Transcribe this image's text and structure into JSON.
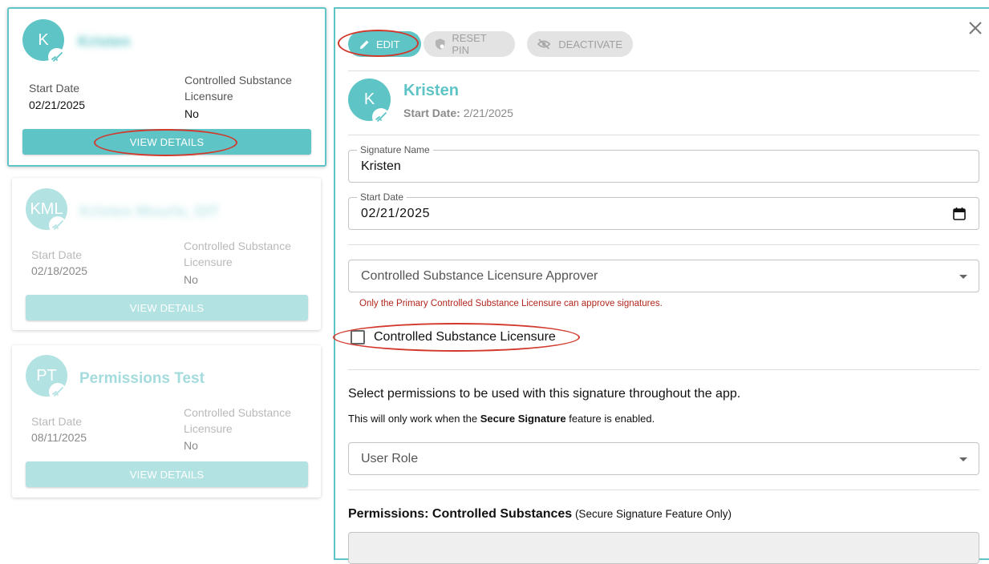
{
  "cards": [
    {
      "initials": "K",
      "name": "Kristen",
      "start_date_label": "Start Date",
      "start_date": "02/21/2025",
      "csl_label_line1": "Controlled Substance",
      "csl_label_line2": "Licensure",
      "csl_value": "No",
      "button": "VIEW DETAILS"
    },
    {
      "initials": "KML",
      "name": "Kristen Mourle, DIT",
      "start_date_label": "Start Date",
      "start_date": "02/18/2025",
      "csl_label_line1": "Controlled Substance",
      "csl_label_line2": "Licensure",
      "csl_value": "No",
      "button": "VIEW DETAILS"
    },
    {
      "initials": "PT",
      "name": "Permissions Test",
      "start_date_label": "Start Date",
      "start_date": "08/11/2025",
      "csl_label_line1": "Controlled Substance",
      "csl_label_line2": "Licensure",
      "csl_value": "No",
      "button": "VIEW DETAILS"
    }
  ],
  "panel": {
    "toolbar": {
      "edit": "EDIT",
      "reset_pin": "RESET PIN",
      "deactivate": "DEACTIVATE"
    },
    "initials": "K",
    "name": "Kristen",
    "start_label": "Start Date:",
    "start_value": "2/21/2025",
    "signature_name_label": "Signature Name",
    "signature_name_value": "Kristen",
    "start_date_field_label": "Start Date",
    "start_date_field_value": "02/21/2025",
    "approver_placeholder": "Controlled Substance Licensure Approver",
    "approver_hint": "Only the Primary Controlled Substance Licensure can approve signatures.",
    "csl_checkbox_label": "Controlled Substance Licensure",
    "permissions_heading": "Select permissions to be used with this signature throughout the app.",
    "permissions_note_pre": "This will only work when the ",
    "permissions_note_bold": "Secure Signature",
    "permissions_note_post": " feature is enabled.",
    "user_role_placeholder": "User Role",
    "perm_cs_title": "Permissions: Controlled Substances",
    "perm_cs_suffix": " (Secure Signature Feature Only)"
  },
  "colors": {
    "accent": "#5fc4c6",
    "accent_light": "#b3e2e3",
    "error": "#b3261e",
    "annotation": "#d2382b"
  }
}
